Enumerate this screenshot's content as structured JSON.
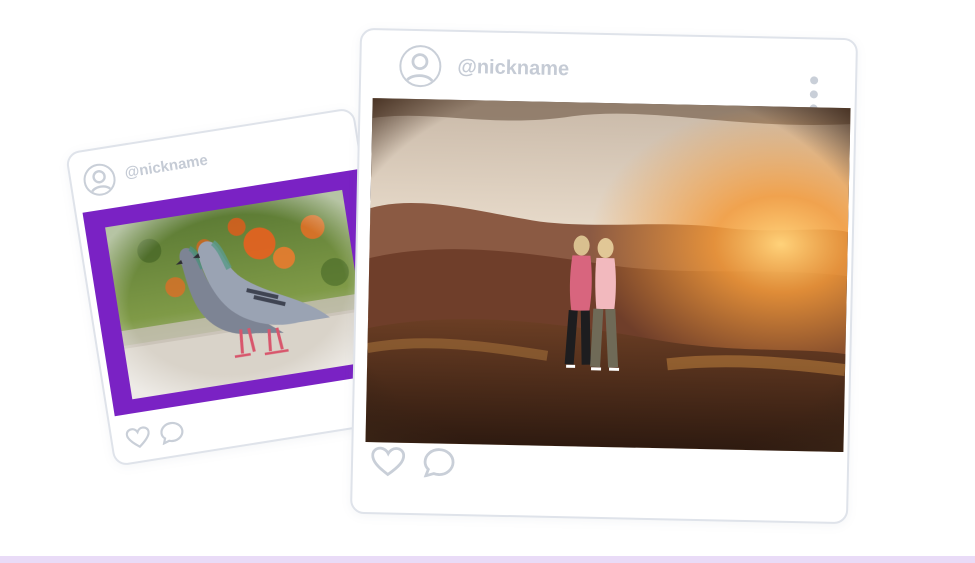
{
  "cards": {
    "back": {
      "username": "@nickname",
      "photo_subject": "two pigeons",
      "frame_color": "#7a22c4"
    },
    "front": {
      "username": "@nickname",
      "photo_subject": "two women on a hilltop at sunset"
    }
  },
  "icons": {
    "avatar": "user-avatar-icon",
    "like": "heart-icon",
    "comment": "comment-icon",
    "more": "more-vertical-icon"
  },
  "colors": {
    "card_border": "#dfe3ea",
    "icon_gray": "#c9cfd8",
    "bottom_strip": "#e9dbf7"
  }
}
